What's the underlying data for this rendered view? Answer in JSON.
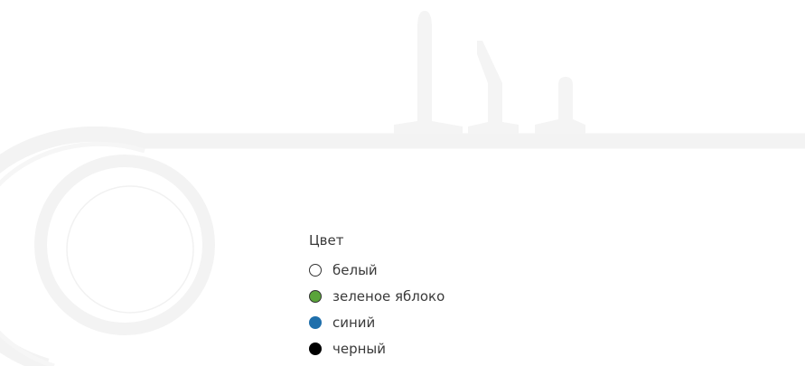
{
  "picker": {
    "title": "Цвет",
    "options": [
      {
        "label": "белый",
        "color": "#ffffff"
      },
      {
        "label": "зеленое яблоко",
        "color": "#5aa43a"
      },
      {
        "label": "синий",
        "color": "#1f6fab"
      },
      {
        "label": "черный",
        "color": "#000000"
      }
    ]
  },
  "theme": {
    "background": "#ffffff",
    "watermark": "#f4f4f4",
    "text": "#3a3a3a"
  }
}
